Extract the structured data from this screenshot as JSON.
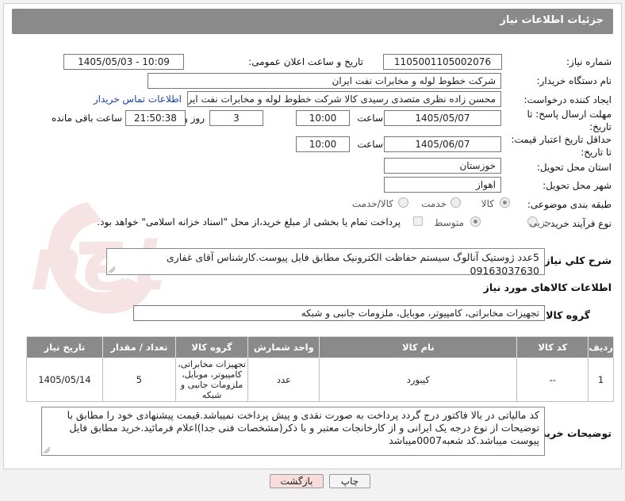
{
  "page": {
    "title": "جزئیات اطلاعات نیاز"
  },
  "fields": {
    "need_number_label": "شماره نیاز:",
    "need_number": "1105001105002076",
    "announce_label": "تاریخ و ساعت اعلان عمومی:",
    "announce_value": "1405/05/03 - 10:09",
    "buyer_label": "نام دستگاه خریدار:",
    "buyer_value": "شرکت خطوط لوله و مخابرات نفت ایران",
    "creator_label": "ایجاد کننده درخواست:",
    "creator_value": "محسن زاده نظری متصدی رسیدی کالا شرکت خطوط لوله و مخابرات نفت ایران",
    "contact_link": "اطلاعات تماس خریدار",
    "deadline_label": "مهلت ارسال پاسخ: تا تاریخ:",
    "deadline_date": "1405/05/07",
    "time_label": "ساعت",
    "deadline_time": "10:00",
    "days_value": "3",
    "days_label": "روز و",
    "remaining_time": "21:50:38",
    "remaining_label": "ساعت باقی مانده",
    "validity_label": "حداقل تاریخ اعتبار قیمت: تا تاریخ:",
    "validity_date": "1405/06/07",
    "validity_time_label": "ساعت",
    "validity_time": "10:00",
    "province_label": "استان محل تحویل:",
    "province_value": "خوزستان",
    "city_label": "شهر محل تحویل:",
    "city_value": "اهواز",
    "category_label": "طبقه بندی موضوعی:",
    "category_options": [
      "کالا",
      "خدمت",
      "کالا/خدمت"
    ],
    "process_label": "نوع فرآیند خرید :",
    "process_options": [
      "جزیی",
      "متوسط"
    ],
    "payment_text": "پرداخت تمام یا بخشی از مبلغ خرید،از محل \"اسناد خزانه اسلامی\" خواهد بود."
  },
  "summary": {
    "label": "شرح کلي نياز:",
    "text": "5عدد ژوستیک آنالوگ سیستم حفاظت الکترونیک مطابق فایل پیوست.کارشناس آقای غفاری 09163037630"
  },
  "goods": {
    "section_title": "اطلاعات کالاهای مورد نیاز",
    "group_label": "گروه کالا:",
    "group_value": "تجهیزات مخابراتی، کامپیوتر، موبایل، ملزومات جانبی و شبکه",
    "table": {
      "headers": [
        "ردیف",
        "کد کالا",
        "نام کالا",
        "واحد شمارش",
        "گروه کالا",
        "تعداد / مقدار",
        "تاریخ نیاز"
      ],
      "rows": [
        [
          "1",
          "--",
          "کیبورد",
          "عدد",
          "تجهیزات مخابراتی، کامپیوتر، موبایل، ملزومات جانبی و شبکه",
          "5",
          "1405/05/14"
        ]
      ]
    }
  },
  "notes": {
    "label": "توضیحات خریدار:",
    "text": "کد مالیاتی در بالا فاکتور درج گردد پرداخت به صورت نقدی و پیش پرداخت نمیباشد.قیمت پیشنهادی خود را مطابق با توضیحات از نوع درجه یک ایرانی و از کارخانجات معتبر و با ذکر(مشخصات فنی جدا)اعلام فرمائید.خرید مطابق فایل پیوست میباشد.کد شعبه0007میباشد"
  },
  "buttons": {
    "print": "چاپ",
    "back": "بازگشت"
  },
  "watermark": {
    "text": "AriaTender.net"
  },
  "colors": {
    "header_bg": "#8a8a8a",
    "link": "#1a44a6",
    "back_bg": "#f9dcdc",
    "watermark": "#c03030"
  }
}
